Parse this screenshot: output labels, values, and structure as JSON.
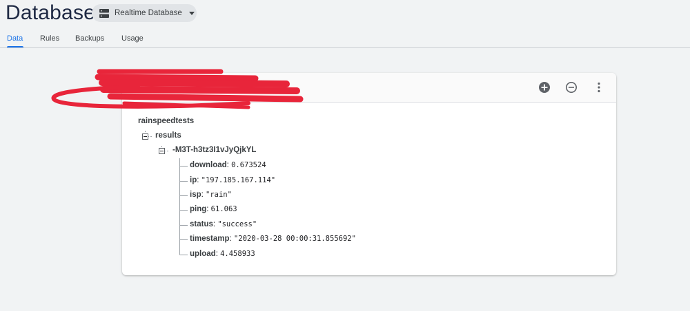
{
  "header": {
    "title": "Database",
    "db_selector": {
      "label": "Realtime Database",
      "icon": "database-icon"
    }
  },
  "tabs": [
    {
      "label": "Data",
      "active": true
    },
    {
      "label": "Rules",
      "active": false
    },
    {
      "label": "Backups",
      "active": false
    },
    {
      "label": "Usage",
      "active": false
    }
  ],
  "toolbar": {
    "add_icon": "add-circle-icon",
    "remove_icon": "remove-circle-icon",
    "more_icon": "more-vert-icon"
  },
  "tree": {
    "root": "rainspeedtests",
    "child": "results",
    "record_id": "-M3T-h3tz3I1vJyQjkYL",
    "fields": [
      {
        "key": "download",
        "value": "0.673524"
      },
      {
        "key": "ip",
        "value": "\"197.185.167.114\""
      },
      {
        "key": "isp",
        "value": "\"rain\""
      },
      {
        "key": "ping",
        "value": "61.063"
      },
      {
        "key": "status",
        "value": "\"success\""
      },
      {
        "key": "timestamp",
        "value": "\"2020-03-28 00:00:31.855692\""
      },
      {
        "key": "upload",
        "value": "4.458933"
      }
    ]
  },
  "colors": {
    "accent": "#1a73e8",
    "redaction": "#e8253a",
    "page_bg": "#f1f3f4"
  }
}
